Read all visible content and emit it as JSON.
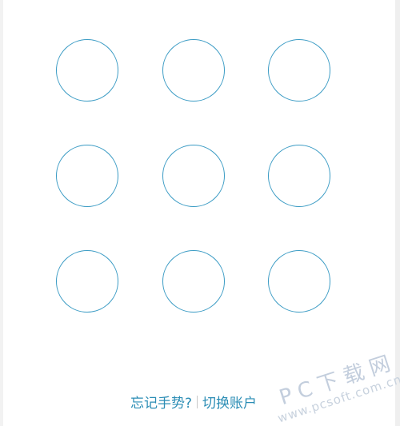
{
  "pattern_lock": {
    "dots": [
      1,
      2,
      3,
      4,
      5,
      6,
      7,
      8,
      9
    ],
    "dot_color": "#3a9bc4"
  },
  "footer": {
    "forgot_gesture": "忘记手势?",
    "switch_account": "切换账户",
    "link_color": "#2b8db5"
  },
  "watermark": {
    "title": "PC下载网",
    "url": "www.pcsoft.com.cn"
  }
}
